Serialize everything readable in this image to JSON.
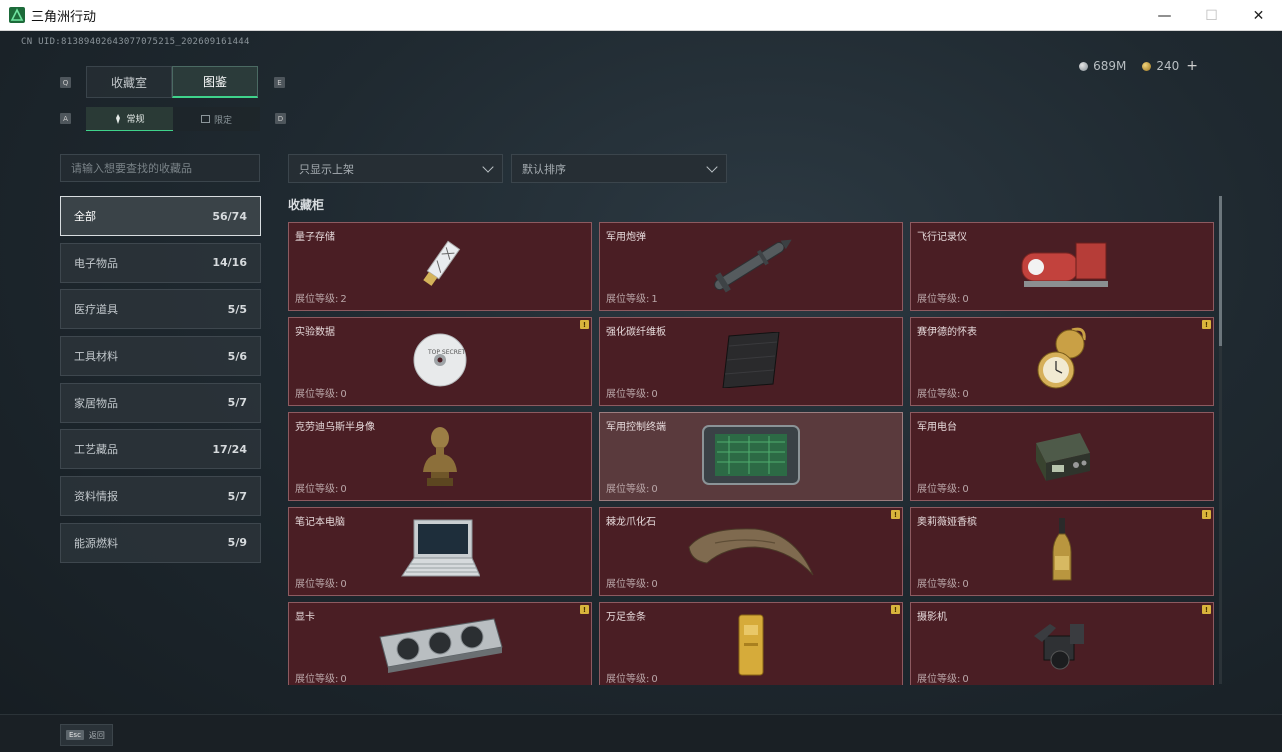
{
  "window": {
    "title": "三角洲行动",
    "minimize": "—",
    "maximize": "☐",
    "close": "✕"
  },
  "uid": "CN UID:8138940264307707521​5_202609161444",
  "currency": {
    "silver": "689M",
    "gold": "240",
    "add": "+"
  },
  "keys": {
    "tab_prev": "Q",
    "tab_next": "E",
    "sub_prev": "A",
    "sub_next": "D"
  },
  "tabs": [
    {
      "label": "收藏室"
    },
    {
      "label": "图鉴"
    }
  ],
  "subtabs": [
    {
      "label": "常规"
    },
    {
      "label": "限定"
    }
  ],
  "search": {
    "placeholder": "请输入想要查找的收藏品"
  },
  "filters": {
    "display": "只显示上架",
    "sort": "默认排序"
  },
  "categories": [
    {
      "label": "全部",
      "count": "56/74"
    },
    {
      "label": "电子物品",
      "count": "14/16"
    },
    {
      "label": "医疗道具",
      "count": "5/5"
    },
    {
      "label": "工具材料",
      "count": "5/6"
    },
    {
      "label": "家居物品",
      "count": "5/7"
    },
    {
      "label": "工艺藏品",
      "count": "17/24"
    },
    {
      "label": "资料情报",
      "count": "5/7"
    },
    {
      "label": "能源燃料",
      "count": "5/9"
    }
  ],
  "section_title": "收藏柜",
  "level_label": "展位等级:",
  "badge_glyph": "!",
  "items": [
    {
      "name": "量子存储",
      "level": "2",
      "badge": false,
      "icon": "usb-drive-icon"
    },
    {
      "name": "军用炮弹",
      "level": "1",
      "badge": false,
      "icon": "missile-icon"
    },
    {
      "name": "飞行记录仪",
      "level": "0",
      "badge": false,
      "icon": "flight-recorder-icon"
    },
    {
      "name": "实验数据",
      "level": "0",
      "badge": true,
      "icon": "disc-icon"
    },
    {
      "name": "强化碳纤维板",
      "level": "0",
      "badge": false,
      "icon": "carbon-plate-icon"
    },
    {
      "name": "赛伊德的怀表",
      "level": "0",
      "badge": true,
      "icon": "pocket-watch-icon"
    },
    {
      "name": "克劳迪乌斯半身像",
      "level": "0",
      "badge": false,
      "icon": "bust-icon"
    },
    {
      "name": "军用控制终端",
      "level": "0",
      "badge": false,
      "icon": "control-terminal-icon"
    },
    {
      "name": "军用电台",
      "level": "0",
      "badge": false,
      "icon": "radio-icon"
    },
    {
      "name": "笔记本电脑",
      "level": "0",
      "badge": false,
      "icon": "laptop-icon"
    },
    {
      "name": "棘龙爪化石",
      "level": "0",
      "badge": true,
      "icon": "claw-fossil-icon"
    },
    {
      "name": "奥莉薇娅香槟",
      "level": "0",
      "badge": true,
      "icon": "champagne-icon"
    },
    {
      "name": "显卡",
      "level": "0",
      "badge": true,
      "icon": "graphics-card-icon"
    },
    {
      "name": "万足金条",
      "level": "0",
      "badge": true,
      "icon": "gold-bar-icon"
    },
    {
      "name": "摄影机",
      "level": "0",
      "badge": true,
      "icon": "camera-icon"
    }
  ],
  "footer": {
    "key": "Esc",
    "label": "返回"
  },
  "colors": {
    "accent": "#3fd38b",
    "card_bg": "#4a1e24",
    "card_border": "#8d5a60",
    "badge": "#d9b43c"
  }
}
